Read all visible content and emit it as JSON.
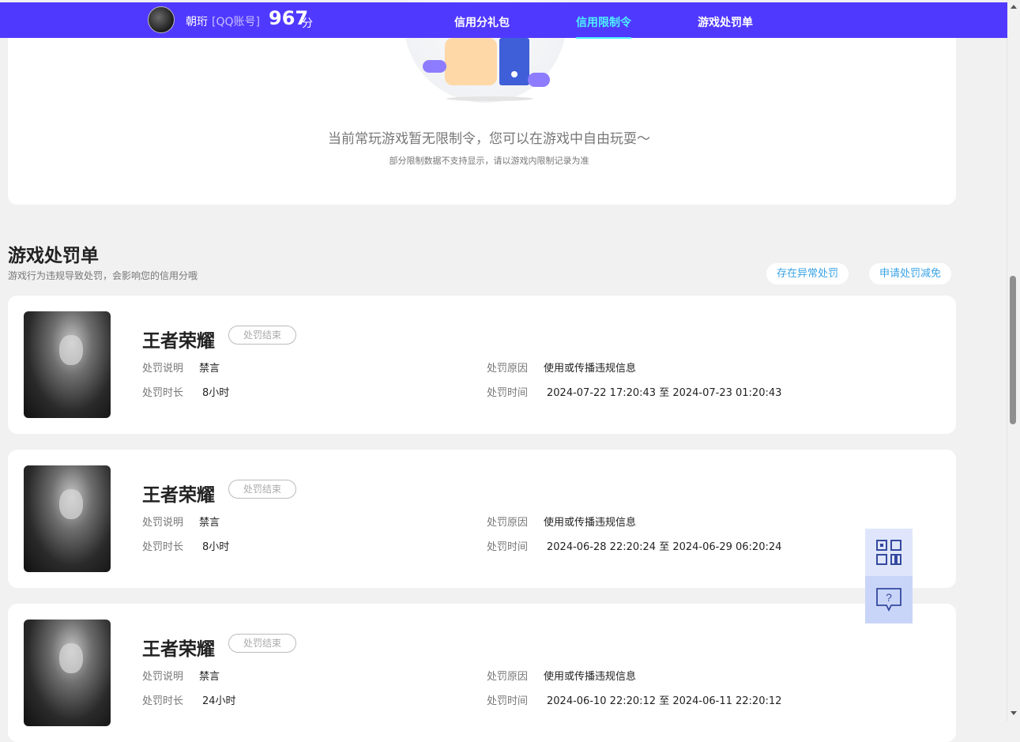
{
  "header": {
    "username": "朝珩",
    "account_type": "[QQ账号]",
    "score": "967",
    "score_unit": "分",
    "tabs": [
      {
        "label": "信用分礼包",
        "active": false
      },
      {
        "label": "信用限制令",
        "active": true
      },
      {
        "label": "游戏处罚单",
        "active": false
      }
    ]
  },
  "restriction": {
    "message": "当前常玩游戏暂无限制令，您可以在游戏中自由玩耍～",
    "note": "部分限制数据不支持显示，请以游戏内限制记录为准"
  },
  "penalty_section": {
    "title": "游戏处罚单",
    "subtitle": "游戏行为违规导致处罚，会影响您的信用分哦",
    "buttons": {
      "abnormal": "存在异常处罚",
      "apply_reduction": "申请处罚减免"
    },
    "labels": {
      "description": "处罚说明",
      "duration": "处罚时长",
      "reason": "处罚原因",
      "time": "处罚时间"
    },
    "cards": [
      {
        "game": "王者荣耀",
        "status": "处罚结束",
        "description": "禁言",
        "duration": "8小时",
        "reason": "使用或传播违规信息",
        "time": "2024-07-22 17:20:43 至 2024-07-23 01:20:43"
      },
      {
        "game": "王者荣耀",
        "status": "处罚结束",
        "description": "禁言",
        "duration": "8小时",
        "reason": "使用或传播违规信息",
        "time": "2024-06-28 22:20:24 至 2024-06-29 06:20:24"
      },
      {
        "game": "王者荣耀",
        "status": "处罚结束",
        "description": "禁言",
        "duration": "24小时",
        "reason": "使用或传播违规信息",
        "time": "2024-06-10 22:20:12 至 2024-06-11 22:20:12"
      }
    ]
  },
  "float_widget": {
    "qr_icon": "qr-code-icon",
    "help_icon": "help-bubble-icon"
  },
  "colors": {
    "nav_bg": "#5039ff",
    "nav_active": "#4ef0ff",
    "pill_text": "#3aa3e6"
  }
}
